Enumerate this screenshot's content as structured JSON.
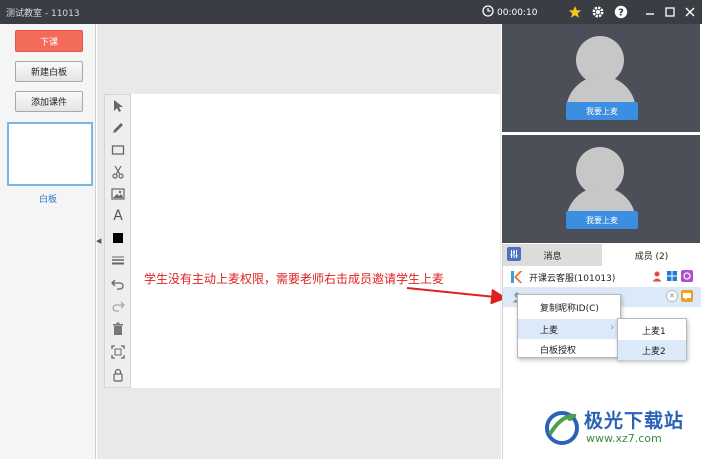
{
  "window": {
    "title": "测试教室 - 11013",
    "timer": "00:00:10",
    "icons": [
      "clock-icon",
      "star-icon",
      "gear-icon",
      "help-icon",
      "minimize-icon",
      "maximize-icon",
      "close-icon"
    ]
  },
  "left_panel": {
    "end_class_label": "下课",
    "new_whiteboard_label": "新建白板",
    "add_courseware_label": "添加课件",
    "thumbnail_label": "白板"
  },
  "toolbar": {
    "tools": [
      "pointer-icon",
      "pen-icon",
      "rectangle-icon",
      "scissors-icon",
      "image-icon",
      "text-icon",
      "color-swatch",
      "line-width-icon",
      "undo-icon",
      "redo-icon",
      "trash-icon",
      "fullscreen-icon",
      "lock-icon"
    ],
    "text_tool_glyph": "A"
  },
  "annotation": {
    "text": "学生没有主动上麦权限，需要老师右击成员邀请学生上麦",
    "color": "#e02020"
  },
  "video": {
    "slot1_button": "我要上麦",
    "slot2_button": "我要上麦"
  },
  "members_panel": {
    "tab_messages": "消息",
    "tab_members": "成员 (2)",
    "member1_name": "开课云客服(101013)"
  },
  "context_menu": {
    "copy_nickname": "复制昵称ID(C)",
    "mic_up": "上麦",
    "whiteboard_auth": "白板授权"
  },
  "submenu": {
    "mic1": "上麦1",
    "mic2": "上麦2"
  },
  "watermark": {
    "title": "极光下载站",
    "url": "www.xz7.com"
  },
  "colors": {
    "titlebar": "#3a3d44",
    "end_class_button": "#f26b5b",
    "accent_blue": "#3b8ee0",
    "menu_highlight": "#dbe9f8"
  }
}
